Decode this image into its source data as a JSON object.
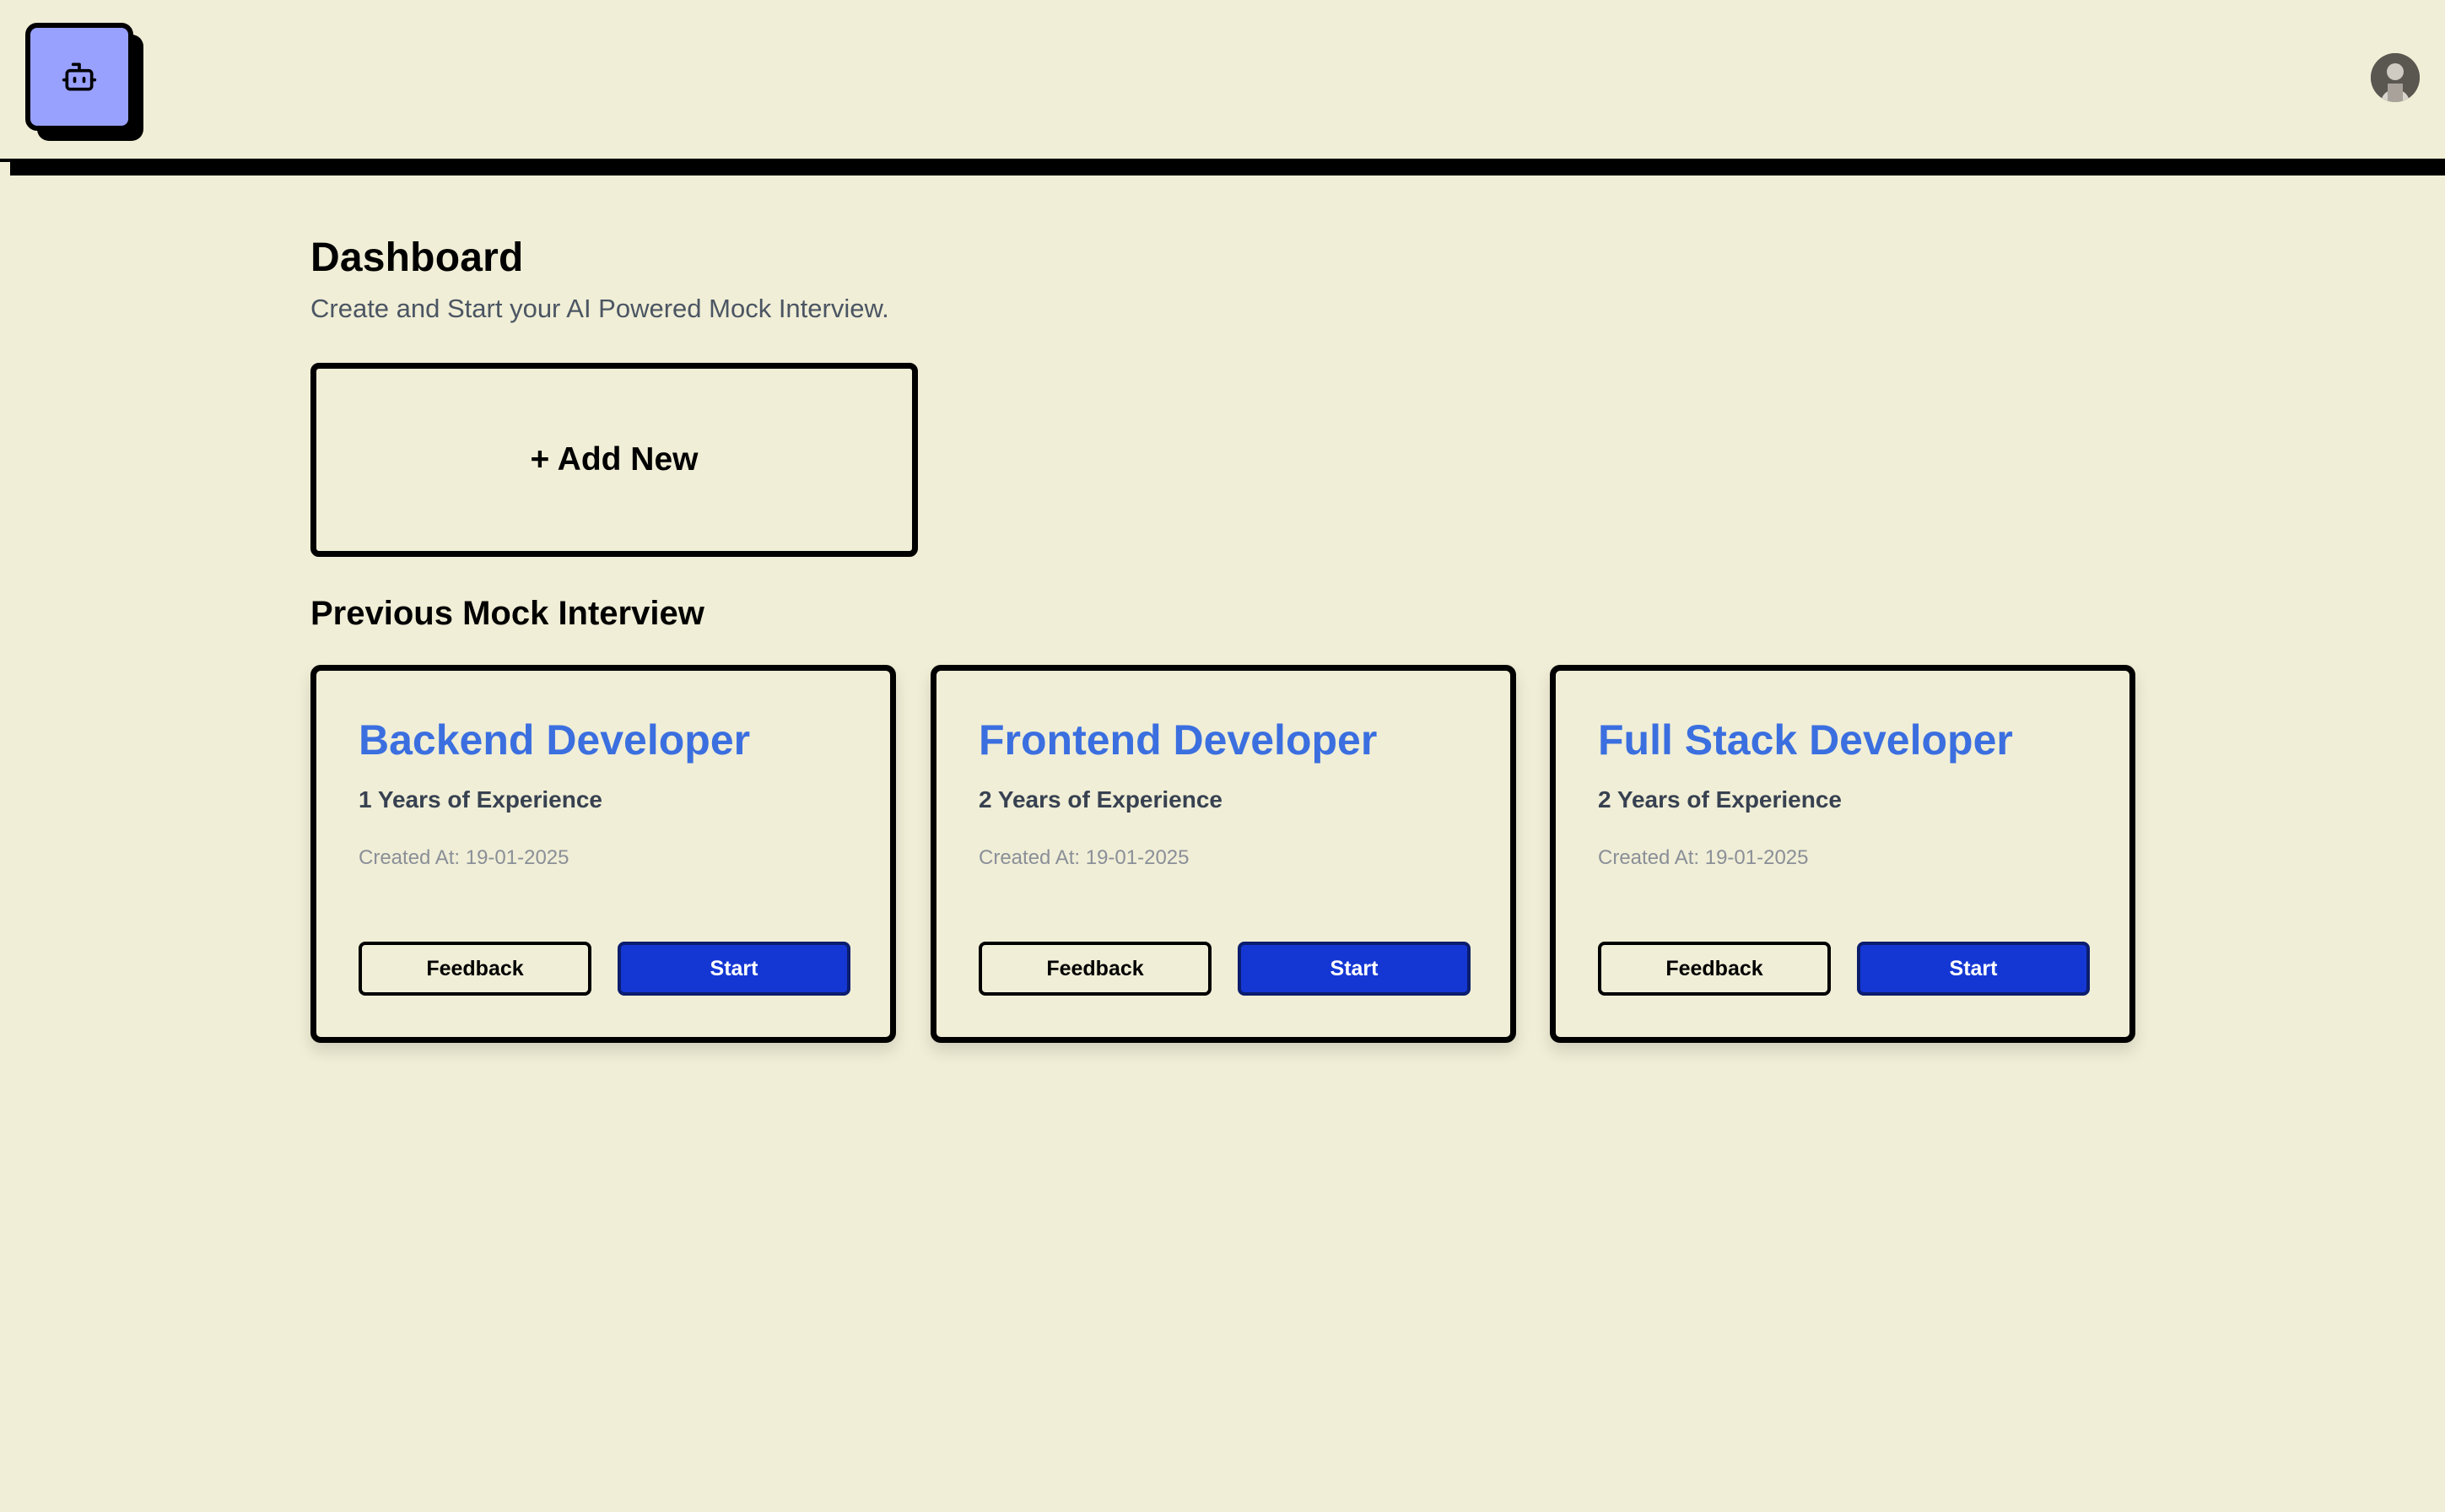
{
  "header": {
    "logo_icon": "robot-icon",
    "logo_color": "#99a1ff",
    "avatar_icon": "user-avatar"
  },
  "dashboard": {
    "title": "Dashboard",
    "subtitle": "Create and Start your AI Powered Mock Interview.",
    "add_new_label": "+ Add New",
    "previous_title": "Previous Mock Interview"
  },
  "interviews": [
    {
      "role": "Backend Developer",
      "experience": "1 Years of Experience",
      "created": "Created At: 19-01-2025",
      "feedback_label": "Feedback",
      "start_label": "Start"
    },
    {
      "role": "Frontend Developer",
      "experience": "2 Years of Experience",
      "created": "Created At: 19-01-2025",
      "feedback_label": "Feedback",
      "start_label": "Start"
    },
    {
      "role": "Full Stack Developer",
      "experience": "2 Years of Experience",
      "created": "Created At: 19-01-2025",
      "feedback_label": "Feedback",
      "start_label": "Start"
    }
  ],
  "colors": {
    "background": "#f0eed6",
    "accent_blue": "#1437d4",
    "title_blue": "#3b6fe0",
    "subtitle_gray": "#4b5563"
  }
}
